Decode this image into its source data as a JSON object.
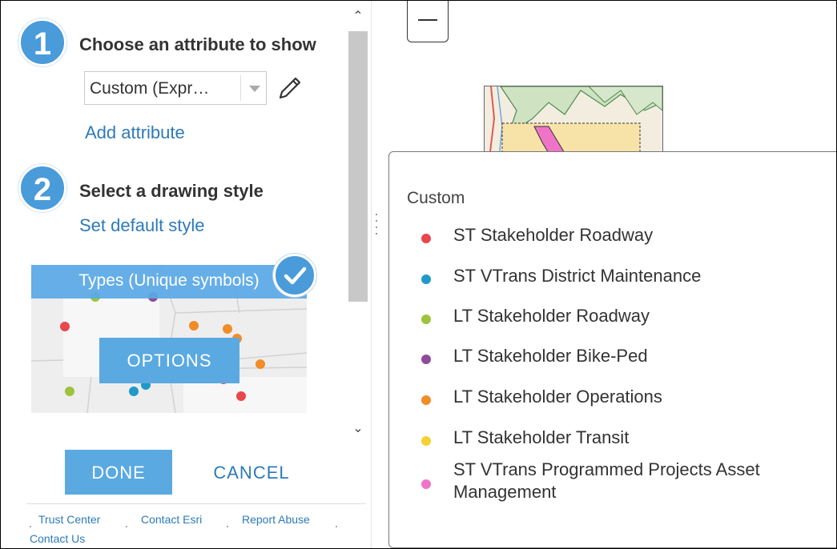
{
  "panel": {
    "step1": {
      "number": "1",
      "title": "Choose an attribute to show"
    },
    "attribute_select": {
      "value": "Custom (Expr…"
    },
    "add_attribute_link": "Add attribute",
    "step2": {
      "number": "2",
      "title": "Select a drawing style"
    },
    "set_default_style_link": "Set default style",
    "style_card": {
      "label": "Types (Unique symbols)",
      "options_button": "OPTIONS",
      "selected": true
    },
    "done_button": "DONE",
    "cancel_button": "CANCEL",
    "footer_links": [
      "Trust Center",
      "Contact Esri",
      "Report Abuse",
      "Contact Us"
    ]
  },
  "legend": {
    "title": "Custom",
    "items": [
      {
        "label": "ST Stakeholder Roadway",
        "color": "#e8474b"
      },
      {
        "label": "ST VTrans District Maintenance",
        "color": "#1f9ac9"
      },
      {
        "label": "LT Stakeholder Roadway",
        "color": "#9cc43c"
      },
      {
        "label": "LT Stakeholder Bike-Ped",
        "color": "#8e4b9a"
      },
      {
        "label": "LT Stakeholder Operations",
        "color": "#f28c28"
      },
      {
        "label": "LT Stakeholder Transit",
        "color": "#f5d033"
      },
      {
        "label": "ST VTrans Programmed Projects Asset Management",
        "color": "#ef74c8"
      }
    ]
  },
  "colors": {
    "accent": "#4a9bd9",
    "link": "#2d7ab8",
    "button": "#5aa9e1"
  },
  "icons": [
    "pencil-icon",
    "checkmark-icon",
    "chevron-up-icon",
    "chevron-down-icon",
    "zoom-out-icon",
    "splitter-handle-icon"
  ]
}
